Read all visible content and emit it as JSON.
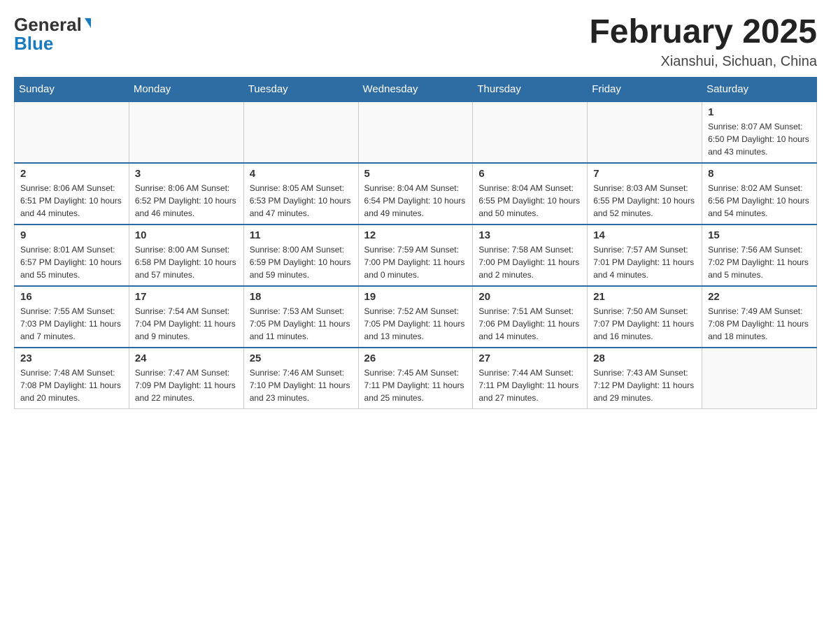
{
  "header": {
    "logo_general": "General",
    "logo_blue": "Blue",
    "month_year": "February 2025",
    "location": "Xianshui, Sichuan, China"
  },
  "weekdays": [
    "Sunday",
    "Monday",
    "Tuesday",
    "Wednesday",
    "Thursday",
    "Friday",
    "Saturday"
  ],
  "weeks": [
    [
      {
        "day": "",
        "info": ""
      },
      {
        "day": "",
        "info": ""
      },
      {
        "day": "",
        "info": ""
      },
      {
        "day": "",
        "info": ""
      },
      {
        "day": "",
        "info": ""
      },
      {
        "day": "",
        "info": ""
      },
      {
        "day": "1",
        "info": "Sunrise: 8:07 AM\nSunset: 6:50 PM\nDaylight: 10 hours and 43 minutes."
      }
    ],
    [
      {
        "day": "2",
        "info": "Sunrise: 8:06 AM\nSunset: 6:51 PM\nDaylight: 10 hours and 44 minutes."
      },
      {
        "day": "3",
        "info": "Sunrise: 8:06 AM\nSunset: 6:52 PM\nDaylight: 10 hours and 46 minutes."
      },
      {
        "day": "4",
        "info": "Sunrise: 8:05 AM\nSunset: 6:53 PM\nDaylight: 10 hours and 47 minutes."
      },
      {
        "day": "5",
        "info": "Sunrise: 8:04 AM\nSunset: 6:54 PM\nDaylight: 10 hours and 49 minutes."
      },
      {
        "day": "6",
        "info": "Sunrise: 8:04 AM\nSunset: 6:55 PM\nDaylight: 10 hours and 50 minutes."
      },
      {
        "day": "7",
        "info": "Sunrise: 8:03 AM\nSunset: 6:55 PM\nDaylight: 10 hours and 52 minutes."
      },
      {
        "day": "8",
        "info": "Sunrise: 8:02 AM\nSunset: 6:56 PM\nDaylight: 10 hours and 54 minutes."
      }
    ],
    [
      {
        "day": "9",
        "info": "Sunrise: 8:01 AM\nSunset: 6:57 PM\nDaylight: 10 hours and 55 minutes."
      },
      {
        "day": "10",
        "info": "Sunrise: 8:00 AM\nSunset: 6:58 PM\nDaylight: 10 hours and 57 minutes."
      },
      {
        "day": "11",
        "info": "Sunrise: 8:00 AM\nSunset: 6:59 PM\nDaylight: 10 hours and 59 minutes."
      },
      {
        "day": "12",
        "info": "Sunrise: 7:59 AM\nSunset: 7:00 PM\nDaylight: 11 hours and 0 minutes."
      },
      {
        "day": "13",
        "info": "Sunrise: 7:58 AM\nSunset: 7:00 PM\nDaylight: 11 hours and 2 minutes."
      },
      {
        "day": "14",
        "info": "Sunrise: 7:57 AM\nSunset: 7:01 PM\nDaylight: 11 hours and 4 minutes."
      },
      {
        "day": "15",
        "info": "Sunrise: 7:56 AM\nSunset: 7:02 PM\nDaylight: 11 hours and 5 minutes."
      }
    ],
    [
      {
        "day": "16",
        "info": "Sunrise: 7:55 AM\nSunset: 7:03 PM\nDaylight: 11 hours and 7 minutes."
      },
      {
        "day": "17",
        "info": "Sunrise: 7:54 AM\nSunset: 7:04 PM\nDaylight: 11 hours and 9 minutes."
      },
      {
        "day": "18",
        "info": "Sunrise: 7:53 AM\nSunset: 7:05 PM\nDaylight: 11 hours and 11 minutes."
      },
      {
        "day": "19",
        "info": "Sunrise: 7:52 AM\nSunset: 7:05 PM\nDaylight: 11 hours and 13 minutes."
      },
      {
        "day": "20",
        "info": "Sunrise: 7:51 AM\nSunset: 7:06 PM\nDaylight: 11 hours and 14 minutes."
      },
      {
        "day": "21",
        "info": "Sunrise: 7:50 AM\nSunset: 7:07 PM\nDaylight: 11 hours and 16 minutes."
      },
      {
        "day": "22",
        "info": "Sunrise: 7:49 AM\nSunset: 7:08 PM\nDaylight: 11 hours and 18 minutes."
      }
    ],
    [
      {
        "day": "23",
        "info": "Sunrise: 7:48 AM\nSunset: 7:08 PM\nDaylight: 11 hours and 20 minutes."
      },
      {
        "day": "24",
        "info": "Sunrise: 7:47 AM\nSunset: 7:09 PM\nDaylight: 11 hours and 22 minutes."
      },
      {
        "day": "25",
        "info": "Sunrise: 7:46 AM\nSunset: 7:10 PM\nDaylight: 11 hours and 23 minutes."
      },
      {
        "day": "26",
        "info": "Sunrise: 7:45 AM\nSunset: 7:11 PM\nDaylight: 11 hours and 25 minutes."
      },
      {
        "day": "27",
        "info": "Sunrise: 7:44 AM\nSunset: 7:11 PM\nDaylight: 11 hours and 27 minutes."
      },
      {
        "day": "28",
        "info": "Sunrise: 7:43 AM\nSunset: 7:12 PM\nDaylight: 11 hours and 29 minutes."
      },
      {
        "day": "",
        "info": ""
      }
    ]
  ]
}
